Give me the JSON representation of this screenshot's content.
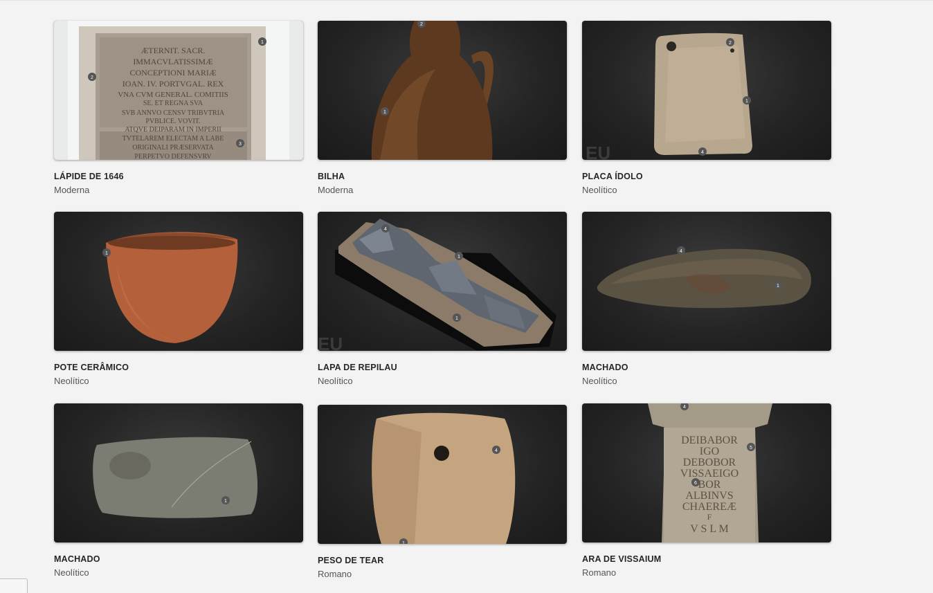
{
  "gallery": {
    "items": [
      {
        "title": "LÁPIDE DE 1646",
        "period": "Moderna"
      },
      {
        "title": "BILHA",
        "period": "Moderna"
      },
      {
        "title": "PLACA ÍDOLO",
        "period": "Neolítico"
      },
      {
        "title": "POTE CERÂMICO",
        "period": "Neolítico"
      },
      {
        "title": "LAPA DE REPILAU",
        "period": "Neolítico"
      },
      {
        "title": "MACHADO",
        "period": "Neolítico"
      },
      {
        "title": "MACHADO",
        "period": "Neolítico"
      },
      {
        "title": "PESO DE TEAR",
        "period": "Romano"
      },
      {
        "title": "ARA DE VISSAIUM",
        "period": "Romano"
      }
    ]
  },
  "inscriptions": {
    "lapide": [
      "ÆTERNIT. SACR.",
      "IMMACVLATISSIMÆ",
      "CONCEPTIONI MARIÆ",
      "IOAN. IV. PORTVGAL. REX",
      "VNA CVM GENERAL. COMITIIS",
      "SE. ET REGNA SVA",
      "SVB ANNVO CENSV TRIBVTRIA",
      "PVBLICE. VOVIT.",
      "ATQVE DEIPARAM IN IMPERII",
      "TVTELAREM ELECTAM A LABE",
      "ORIGINALI PRÆSERVATA",
      "PERPETVO DEFENSVRV"
    ],
    "ara": [
      "DEIBABOR",
      "IGO",
      "DEBOBOR",
      "VISSAEIGO",
      "BOR",
      "ALBINVS",
      "CHAEREÆ",
      "F",
      "V S L M"
    ]
  },
  "watermark": "EU",
  "colors": {
    "background": "#f3f3f3",
    "thumb_bg": "#232323",
    "title": "#262626",
    "subtitle": "#555555"
  }
}
